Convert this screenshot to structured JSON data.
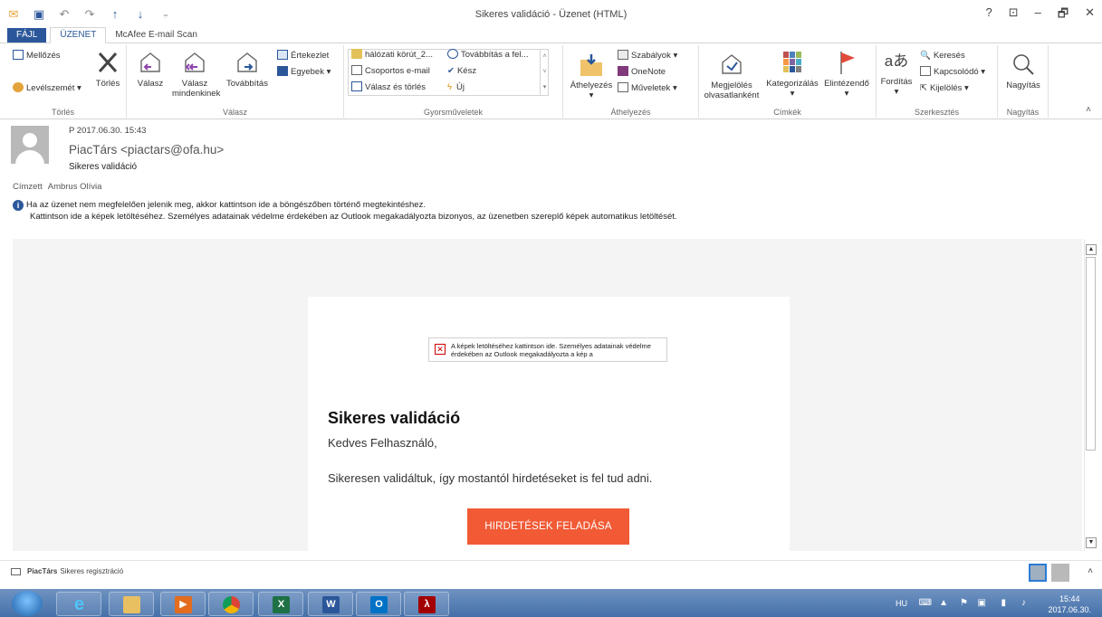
{
  "window": {
    "title": "Sikeres validáció - Üzenet (HTML)",
    "controls": [
      "?",
      "⊡",
      "–",
      "🗗",
      "✕"
    ]
  },
  "tabs": [
    "FÁJL",
    "ÜZENET",
    "McAfee E-mail Scan"
  ],
  "ribbon": {
    "torles": {
      "group": "Törlés",
      "ignore": "Mellőzés",
      "junk": "Levélszemét",
      "delete": "Törlés"
    },
    "valasz": {
      "group": "Válasz",
      "reply": "Válasz",
      "reply_all_1": "Válasz",
      "reply_all_2": "mindenkinek",
      "forward": "Továbbítás",
      "meeting": "Értekezlet",
      "more": "Egyebek"
    },
    "gyors": {
      "group": "Gyorsműveletek",
      "items": [
        "hálózati körút_2...",
        "Csoportos e-mail",
        "Válasz és törlés",
        "Továbbítás a fel...",
        "Kész",
        "Új"
      ]
    },
    "athely": {
      "group": "Áthelyezés",
      "move": "Áthelyezés",
      "rules": "Szabályok",
      "onenote": "OneNote",
      "actions": "Műveletek"
    },
    "cimkek": {
      "group": "Címkék",
      "unread_1": "Megjelölés",
      "unread_2": "olvasatlanként",
      "categorize": "Kategorizálás",
      "followup": "Elintézendő"
    },
    "szerk": {
      "group": "Szerkesztés",
      "translate": "Fordítás",
      "find": "Keresés",
      "related": "Kapcsolódó",
      "select": "Kijelölés"
    },
    "nagy": {
      "group": "Nagyítás",
      "zoom": "Nagyítás"
    }
  },
  "header": {
    "date": "P 2017.06.30. 15:43",
    "from": "PiacTárs <piactars@ofa.hu>",
    "subject": "Sikeres validáció",
    "to_label": "Címzett",
    "to": "Ambrus Olívia",
    "info_line1": "Ha az üzenet nem megfelelően jelenik meg, akkor kattintson ide a böngészőben történő megtekintéshez.",
    "info_line2": "Kattintson ide a képek letöltéséhez. Személyes adatainak védelme érdekében az Outlook megakadályozta bizonyos, az üzenetben szereplő képek automatikus letöltését."
  },
  "email": {
    "image_placeholder": "A képek letöltéséhez kattintson ide. Személyes adatainak védelme érdekében az Outlook megakadályozta a kép a",
    "title": "Sikeres validáció",
    "greeting": "Kedves Felhasználó,",
    "message": "Sikeresen validáltuk, így mostantól hirdetéseket is fel tud adni.",
    "cta": "HIRDETÉSEK FELADÁSA",
    "cta_color": "#f15a35"
  },
  "people_pane": {
    "name": "PiacTárs",
    "text": "Sikeres regisztráció"
  },
  "taskbar": {
    "apps": [
      "IE",
      "Explorer",
      "Media Player",
      "Chrome",
      "Excel",
      "Word",
      "Outlook",
      "Acrobat"
    ],
    "lang": "HU",
    "time": "15:44",
    "date": "2017.06.30."
  },
  "colors": {
    "accent": "#2b579a",
    "taskbar": "#4570a8"
  }
}
